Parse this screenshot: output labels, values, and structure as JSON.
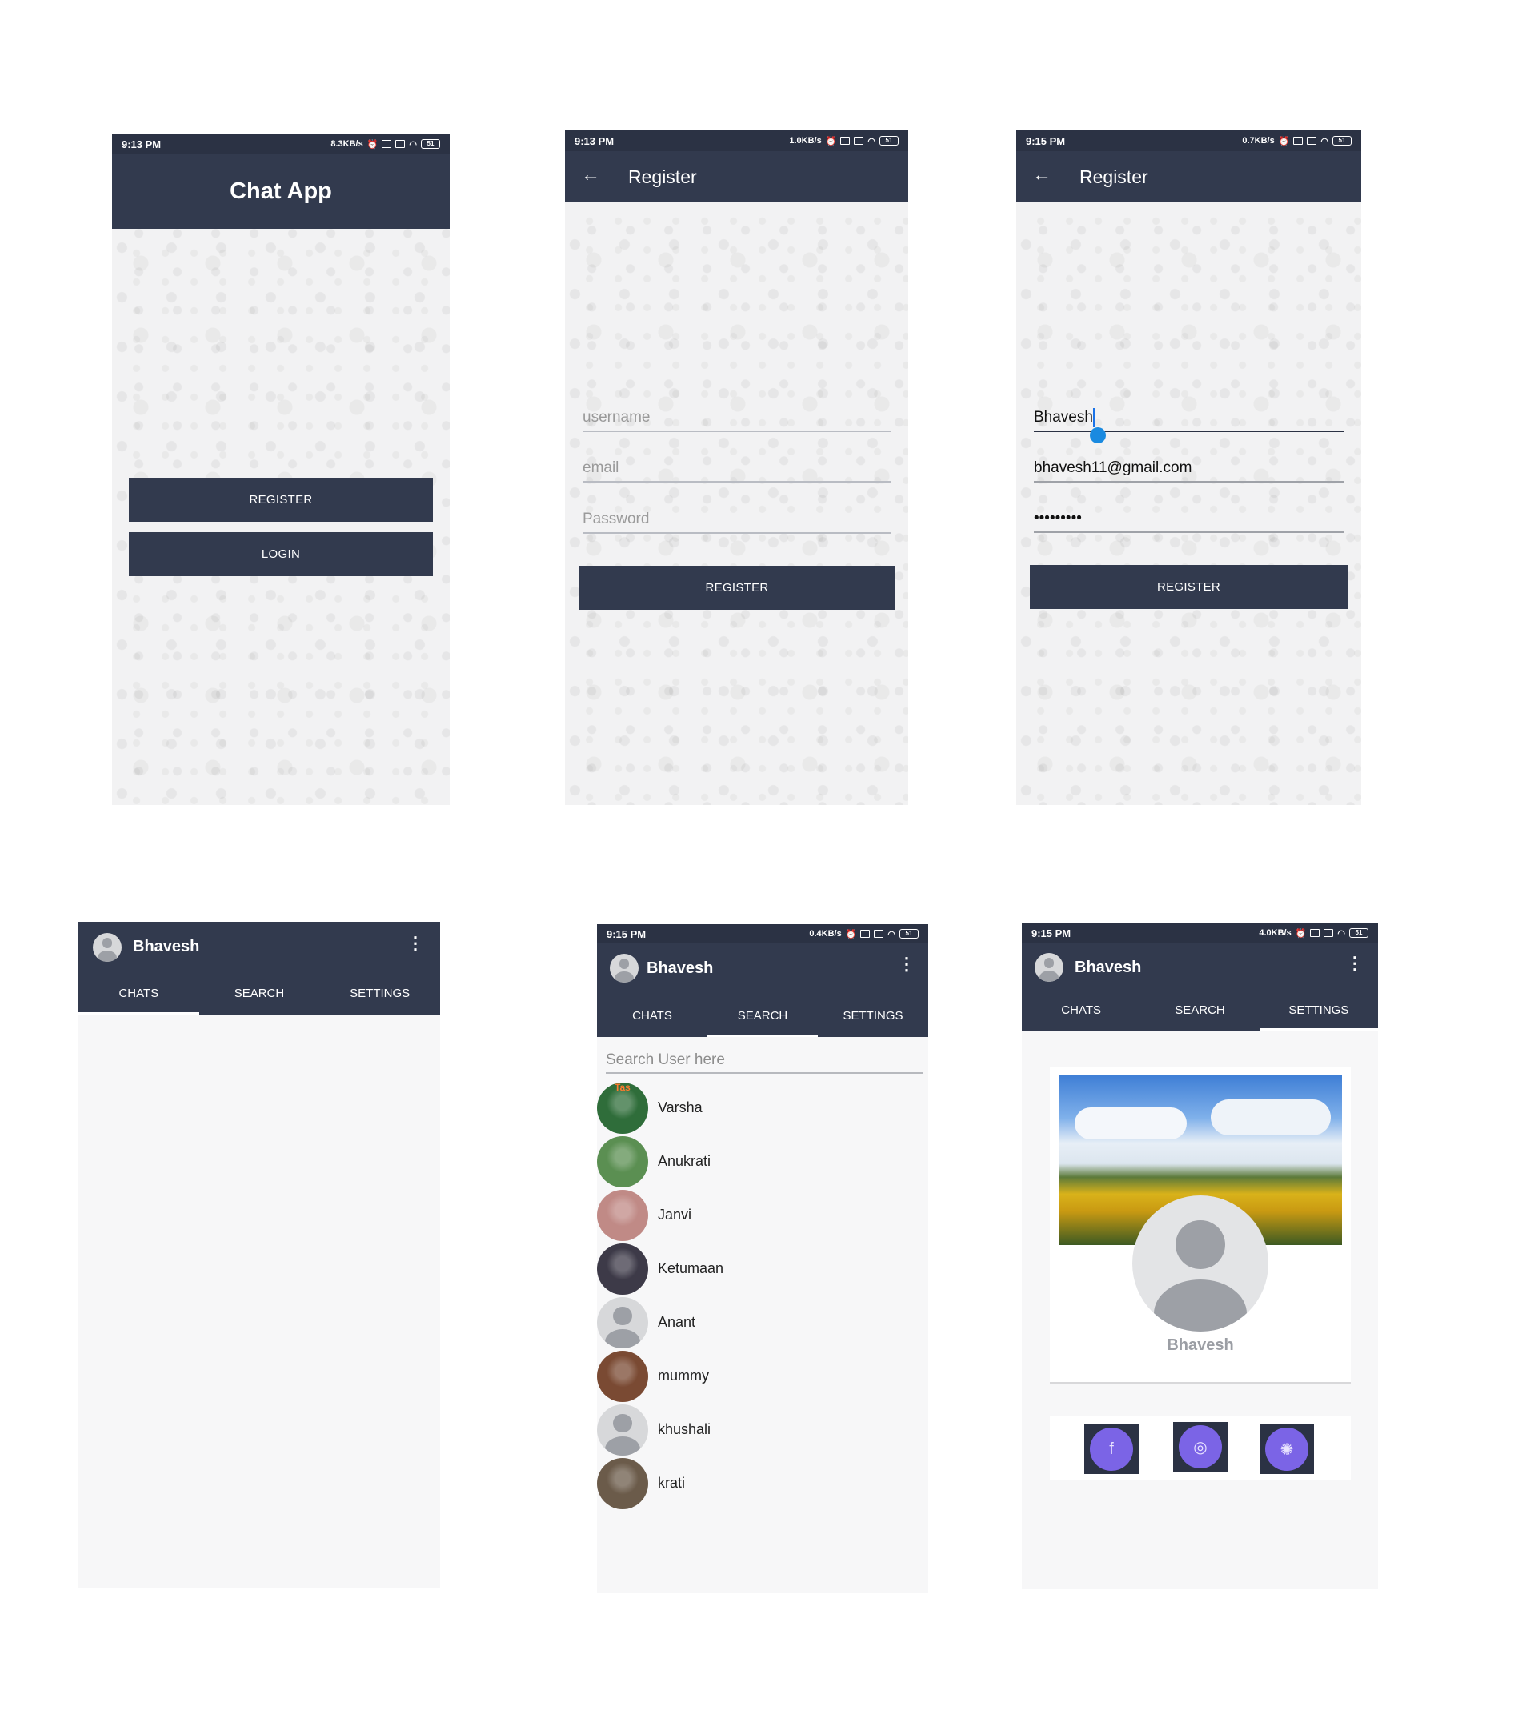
{
  "screen1": {
    "status": {
      "time": "9:13 PM",
      "speed": "8.3KB/s",
      "battery": "51"
    },
    "title": "Chat App",
    "register_label": "REGISTER",
    "login_label": "LOGIN"
  },
  "screen2": {
    "status": {
      "time": "9:13 PM",
      "speed": "1.0KB/s",
      "battery": "51"
    },
    "title": "Register",
    "username_placeholder": "username",
    "email_placeholder": "email",
    "password_placeholder": "Password",
    "register_label": "REGISTER"
  },
  "screen3": {
    "status": {
      "time": "9:15 PM",
      "speed": "0.7KB/s",
      "battery": "51"
    },
    "title": "Register",
    "username_value": "Bhavesh",
    "email_value": "bhavesh11@gmail.com",
    "password_value": "•••••••••",
    "register_label": "REGISTER"
  },
  "screen4": {
    "user": "Bhavesh",
    "tabs": [
      "CHATS",
      "SEARCH",
      "SETTINGS"
    ],
    "active_tab": 0
  },
  "screen5": {
    "status": {
      "time": "9:15 PM",
      "speed": "0.4KB/s",
      "battery": "51"
    },
    "user": "Bhavesh",
    "tabs": [
      "CHATS",
      "SEARCH",
      "SETTINGS"
    ],
    "active_tab": 1,
    "search_placeholder": "Search User here",
    "users": [
      {
        "name": "Varsha",
        "avatar": "photo-night",
        "color": "#2f6d3a",
        "badge": "Tas"
      },
      {
        "name": "Anukrati",
        "avatar": "photo-green",
        "color": "#5b8f52"
      },
      {
        "name": "Janvi",
        "avatar": "photo-pink",
        "color": "#c08a86"
      },
      {
        "name": "Ketumaan",
        "avatar": "photo-dark",
        "color": "#3d3a48"
      },
      {
        "name": "Anant",
        "avatar": "default-avatar"
      },
      {
        "name": "mummy",
        "avatar": "photo-brown",
        "color": "#7a4a33"
      },
      {
        "name": "khushali",
        "avatar": "default-avatar"
      },
      {
        "name": "krati",
        "avatar": "photo-street",
        "color": "#6b5b4a"
      }
    ]
  },
  "screen6": {
    "status": {
      "time": "9:15 PM",
      "speed": "4.0KB/s",
      "battery": "51"
    },
    "user": "Bhavesh",
    "tabs": [
      "CHATS",
      "SEARCH",
      "SETTINGS"
    ],
    "active_tab": 2,
    "profile_name": "Bhavesh",
    "socials": [
      "facebook-icon",
      "instagram-icon",
      "dribbble-icon"
    ],
    "social_glyphs": [
      "f",
      "◎",
      "✺"
    ]
  }
}
